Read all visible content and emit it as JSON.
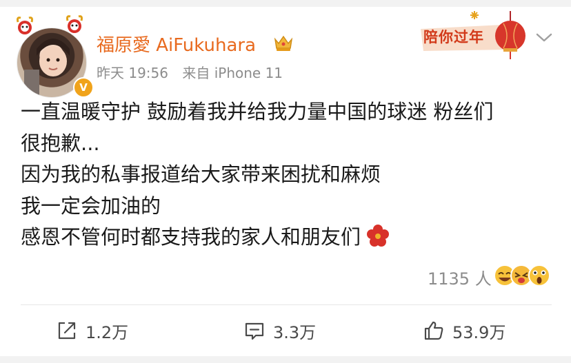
{
  "post": {
    "username": "福原愛 AiFukuhara",
    "time": "昨天 19:56",
    "source": "来自 iPhone 11",
    "festival_badge": "陪你过年",
    "lines": [
      "一直温暖守护 鼓励着我并给我力量中国的球迷 粉丝们",
      "很抱歉...",
      "因为我的私事报道给大家带来困扰和麻烦",
      "我一定会加油的",
      "感恩不管何时都支持我的家人和朋友们"
    ],
    "reaction_count": "1135 人",
    "vip_mark": "V"
  },
  "actions": {
    "repost_count": "1.2万",
    "comment_count": "3.3万",
    "like_count": "53.9万"
  },
  "colors": {
    "username": "#e86a1f",
    "meta": "#8c8c8c",
    "festival_red": "#d23a1a"
  },
  "icons": [
    "repost-icon",
    "comment-icon",
    "like-icon",
    "crown-icon",
    "chevron-down-icon",
    "flower-icon",
    "vip-badge"
  ]
}
